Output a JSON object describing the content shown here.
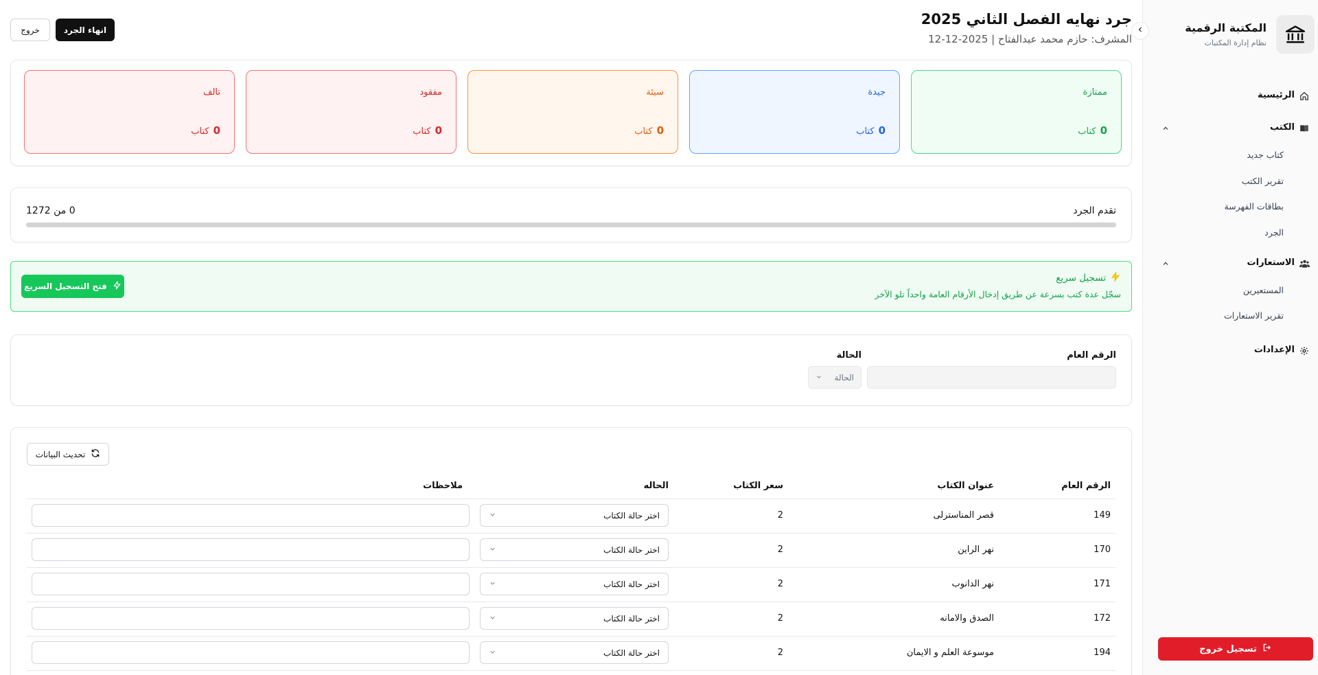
{
  "brand": {
    "title": "المكتبة الرقمية",
    "subtitle": "نظام إدارة المكتبات",
    "logo_icon": "library-building-icon"
  },
  "nav": {
    "home": "الرئيسية",
    "books": "الكتب",
    "books_items": [
      "كتاب جديد",
      "تقرير الكتب",
      "بطاقات الفهرسة",
      "الجرد"
    ],
    "loans": "الاستعارات",
    "loans_items": [
      "المستعيرين",
      "تقرير الاستعارات"
    ],
    "settings": "الإعدادات",
    "logout": "تسجيل خروج"
  },
  "header": {
    "title": "جرد نهايه الفصل الثاني 2025",
    "subtitle": "المشرف: حازم محمد عبدالفتاح | 2025-12-12",
    "end_button": "انهاء الجرد",
    "exit_button": "خروج"
  },
  "stats": [
    {
      "label": "ممتازة",
      "count": "0",
      "unit": "كتاب",
      "color": "#16a34a",
      "bg": "#f0fdf4",
      "border": "#4ade80"
    },
    {
      "label": "جيدة",
      "count": "0",
      "unit": "كتاب",
      "color": "#2563eb",
      "bg": "#eff6ff",
      "border": "#60a5fa"
    },
    {
      "label": "سيئة",
      "count": "0",
      "unit": "كتاب",
      "color": "#ea580c",
      "bg": "#fff7ed",
      "border": "#fb923c"
    },
    {
      "label": "مفقود",
      "count": "0",
      "unit": "كتاب",
      "color": "#dc2626",
      "bg": "#fef2f2",
      "border": "#f87171"
    },
    {
      "label": "تالف",
      "count": "0",
      "unit": "كتاب",
      "color": "#dc2626",
      "bg": "#fef2f2",
      "border": "#f87171"
    }
  ],
  "progress": {
    "label": "تقدم الجرد",
    "count_text": "0 من 1272",
    "fraction": 0
  },
  "quick": {
    "title": "تسجيل سريع",
    "description": "سجّل عدة كتب بسرعة عن طريق إدخال الأرقام العامة واحداً تلو الآخر",
    "button": "فتح التسجيل السريع"
  },
  "filters": {
    "number_label": "الرقم العام",
    "number_value": "",
    "status_label": "الحالة",
    "status_value": "الحالة"
  },
  "table": {
    "refresh_button": "تحديث البيانات",
    "headers": {
      "number": "الرقم العام",
      "title": "عنوان الكتاب",
      "price": "سعر الكتاب",
      "status": "الحاله",
      "notes": "ملاحظات"
    },
    "status_placeholder": "اختر حالة الكتاب",
    "rows": [
      {
        "number": "149",
        "title": "قصر المناسترلى",
        "price": "2"
      },
      {
        "number": "170",
        "title": "نهر الراين",
        "price": "2"
      },
      {
        "number": "171",
        "title": "نهر الدانوب",
        "price": "2"
      },
      {
        "number": "172",
        "title": "الصدق والامانه",
        "price": "2"
      },
      {
        "number": "194",
        "title": "موسوعة العلم و الايمان",
        "price": "2"
      }
    ]
  }
}
